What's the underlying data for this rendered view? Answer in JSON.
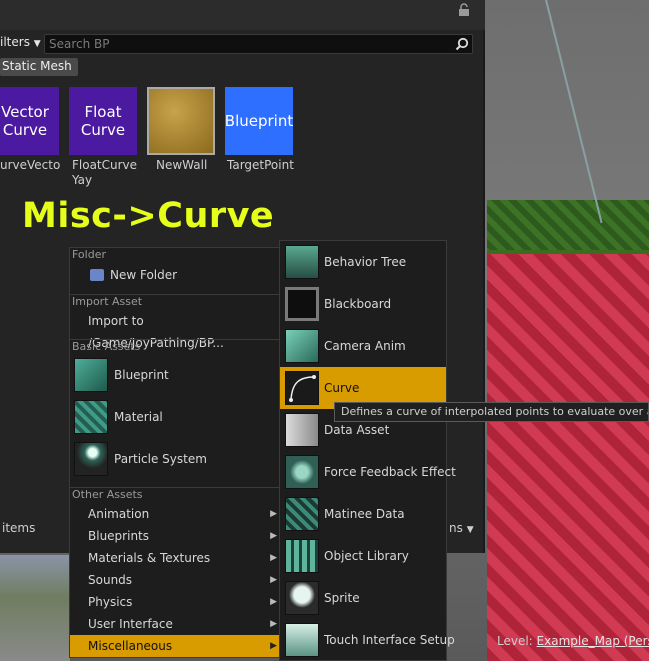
{
  "content_browser": {
    "filters_label": "ilters",
    "search_placeholder": "Search BP",
    "filter_chip": "Static Mesh",
    "tiles": [
      {
        "thumb_text": "Vector\nCurve",
        "label": "urveVecto",
        "color": "#4b1aa0"
      },
      {
        "thumb_text": "Float\nCurve",
        "label": "FloatCurve\nYay",
        "color": "#4b1aa0"
      },
      {
        "thumb_text": "",
        "label": "NewWall",
        "color": "#b38b2c"
      },
      {
        "thumb_text": "Blueprint",
        "label": "TargetPoint",
        "color": "#2f6fff"
      }
    ],
    "items_count": "items",
    "view_options": "ns"
  },
  "annotation": "Misc->Curve",
  "context_menu": {
    "sections": {
      "folder": "Folder",
      "import": "Import Asset",
      "basic": "Basic Assets",
      "other": "Other Assets"
    },
    "new_folder": "New Folder",
    "import_to": "Import to /Game/JoyPathing/BP...",
    "basic_assets": [
      "Blueprint",
      "Material",
      "Particle System"
    ],
    "other_assets": [
      "Animation",
      "Blueprints",
      "Materials & Textures",
      "Sounds",
      "Physics",
      "User Interface",
      "Miscellaneous"
    ],
    "selected": "Miscellaneous"
  },
  "submenu": {
    "items": [
      "Behavior Tree",
      "Blackboard",
      "Camera Anim",
      "Curve",
      "Data Asset",
      "Force Feedback Effect",
      "Matinee Data",
      "Object Library",
      "Sprite",
      "Touch Interface Setup"
    ],
    "selected": "Curve"
  },
  "tooltip": "Defines a curve of interpolated points to evaluate over a given",
  "status": {
    "level_label": "Level:",
    "level_name": "Example_Map (Persis"
  }
}
